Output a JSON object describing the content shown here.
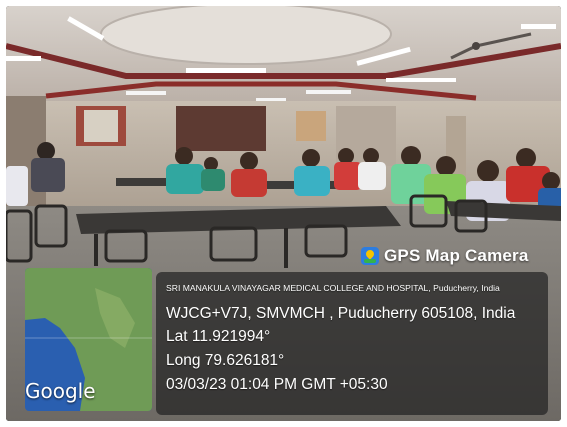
{
  "photo": {
    "description_icon": "gps-map-camera-icon"
  },
  "overlay": {
    "app_badge": "GPS Map Camera",
    "location_line": "SRI MANAKULA VINAYAGAR MEDICAL COLLEGE AND HOSPITAL, Puducherry, India",
    "address": "WJCG+V7J, SMVMCH , Puducherry 605108, India",
    "latitude": "Lat 11.921994°",
    "longitude": "Long 79.626181°",
    "timestamp": "03/03/23 01:04 PM GMT +05:30"
  },
  "map": {
    "provider_label": "Google",
    "land_color": "#6f9b56",
    "water_color": "#2a5fb0"
  }
}
